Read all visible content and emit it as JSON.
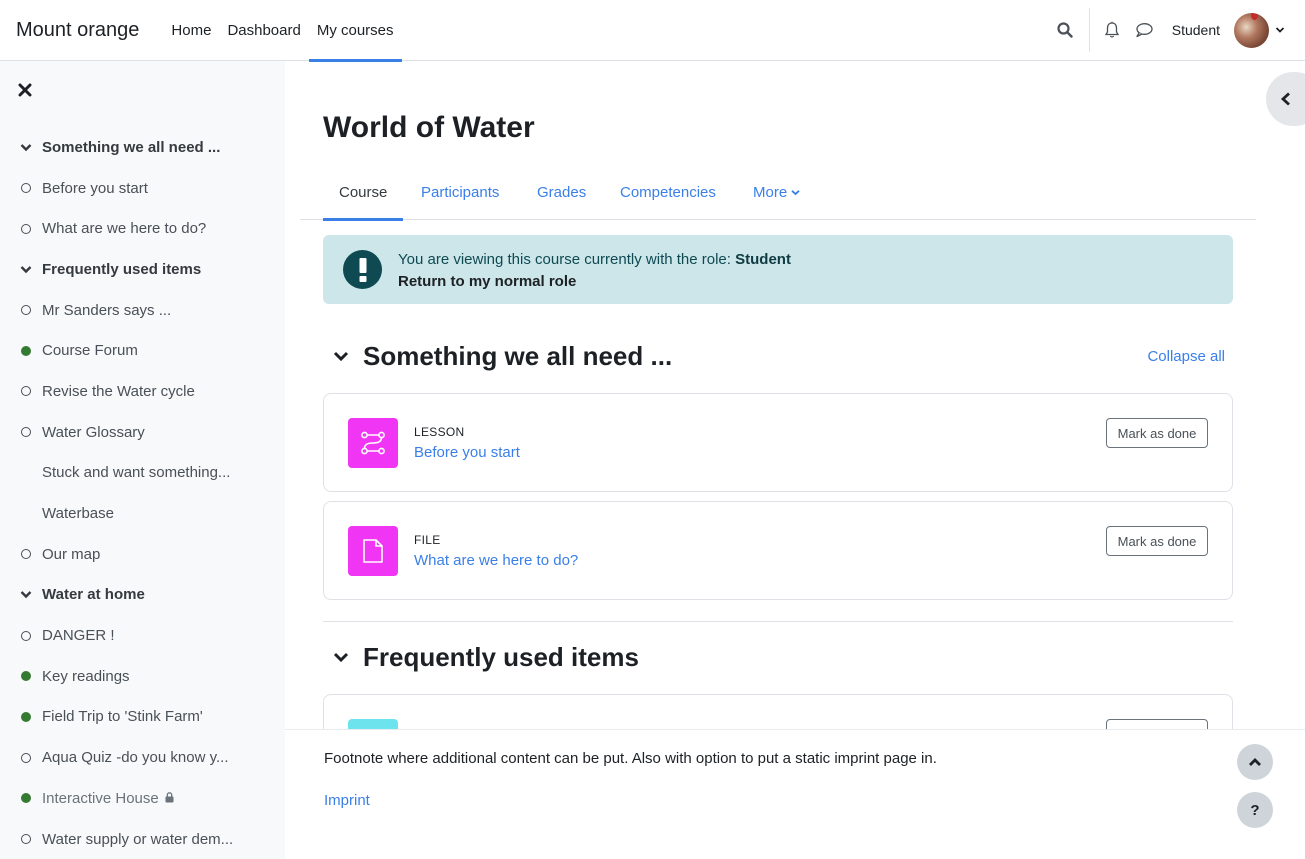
{
  "navbar": {
    "brand": "Mount orange",
    "links": [
      {
        "label": "Home",
        "active": false
      },
      {
        "label": "Dashboard",
        "active": false
      },
      {
        "label": "My courses",
        "active": true
      }
    ],
    "user_name": "Student",
    "icons": [
      "search-icon",
      "bell-icon",
      "chat-bubble-icon",
      "avatar",
      "chevron-down-icon"
    ]
  },
  "sidebar": {
    "close_icon": "close-icon",
    "items": [
      {
        "label": "Something we all need ...",
        "type": "section",
        "marker": "chevron-down"
      },
      {
        "label": "Before you start",
        "type": "activity",
        "marker": "incomplete"
      },
      {
        "label": "What are we here to do?",
        "type": "activity",
        "marker": "incomplete"
      },
      {
        "label": "Frequently used items",
        "type": "section",
        "marker": "chevron-down"
      },
      {
        "label": "Mr Sanders says ...",
        "type": "activity",
        "marker": "incomplete"
      },
      {
        "label": "Course Forum",
        "type": "activity",
        "marker": "complete"
      },
      {
        "label": "Revise the Water cycle",
        "type": "activity",
        "marker": "incomplete"
      },
      {
        "label": "Water Glossary",
        "type": "activity",
        "marker": "incomplete"
      },
      {
        "label": "Stuck and want something...",
        "type": "activity",
        "marker": "none"
      },
      {
        "label": "Waterbase",
        "type": "activity",
        "marker": "none"
      },
      {
        "label": "Our map",
        "type": "activity",
        "marker": "incomplete"
      },
      {
        "label": "Water at home",
        "type": "section",
        "marker": "chevron-down"
      },
      {
        "label": "DANGER !",
        "type": "activity",
        "marker": "incomplete"
      },
      {
        "label": "Key readings",
        "type": "activity",
        "marker": "complete"
      },
      {
        "label": "Field Trip to 'Stink Farm'",
        "type": "activity",
        "marker": "complete"
      },
      {
        "label": "Aqua Quiz -do you know y...",
        "type": "activity",
        "marker": "incomplete"
      },
      {
        "label": "Interactive House",
        "type": "activity",
        "marker": "complete",
        "locked": true
      },
      {
        "label": "Water supply or water dem...",
        "type": "activity",
        "marker": "incomplete"
      }
    ]
  },
  "course": {
    "title": "World of Water",
    "tabs": [
      {
        "label": "Course",
        "active": true
      },
      {
        "label": "Participants",
        "active": false
      },
      {
        "label": "Grades",
        "active": false
      },
      {
        "label": "Competencies",
        "active": false
      },
      {
        "label": "More",
        "active": false,
        "dropdown": true
      }
    ],
    "alert": {
      "text": "You are viewing this course currently with the role:",
      "role": "Student",
      "link": "Return to my normal role"
    },
    "collapse_all": "Collapse all",
    "sections": [
      {
        "title": "Something we all need ...",
        "activities": [
          {
            "type": "LESSON",
            "name": "Before you start",
            "icon": "lesson-icon",
            "button": "Mark as done"
          },
          {
            "type": "FILE",
            "name": "What are we here to do?",
            "icon": "file-icon",
            "button": "Mark as done"
          }
        ]
      },
      {
        "title": "Frequently used items",
        "activities": []
      }
    ]
  },
  "colors": {
    "accent": "#3a7fe8",
    "activity_icon": "#f036f4",
    "alert_bg": "#cce6ea",
    "complete": "#357a32"
  },
  "footer": {
    "note": "Footnote where additional content can be put. Also with option to put a static imprint page in.",
    "imprint": "Imprint",
    "help_label": "?"
  }
}
